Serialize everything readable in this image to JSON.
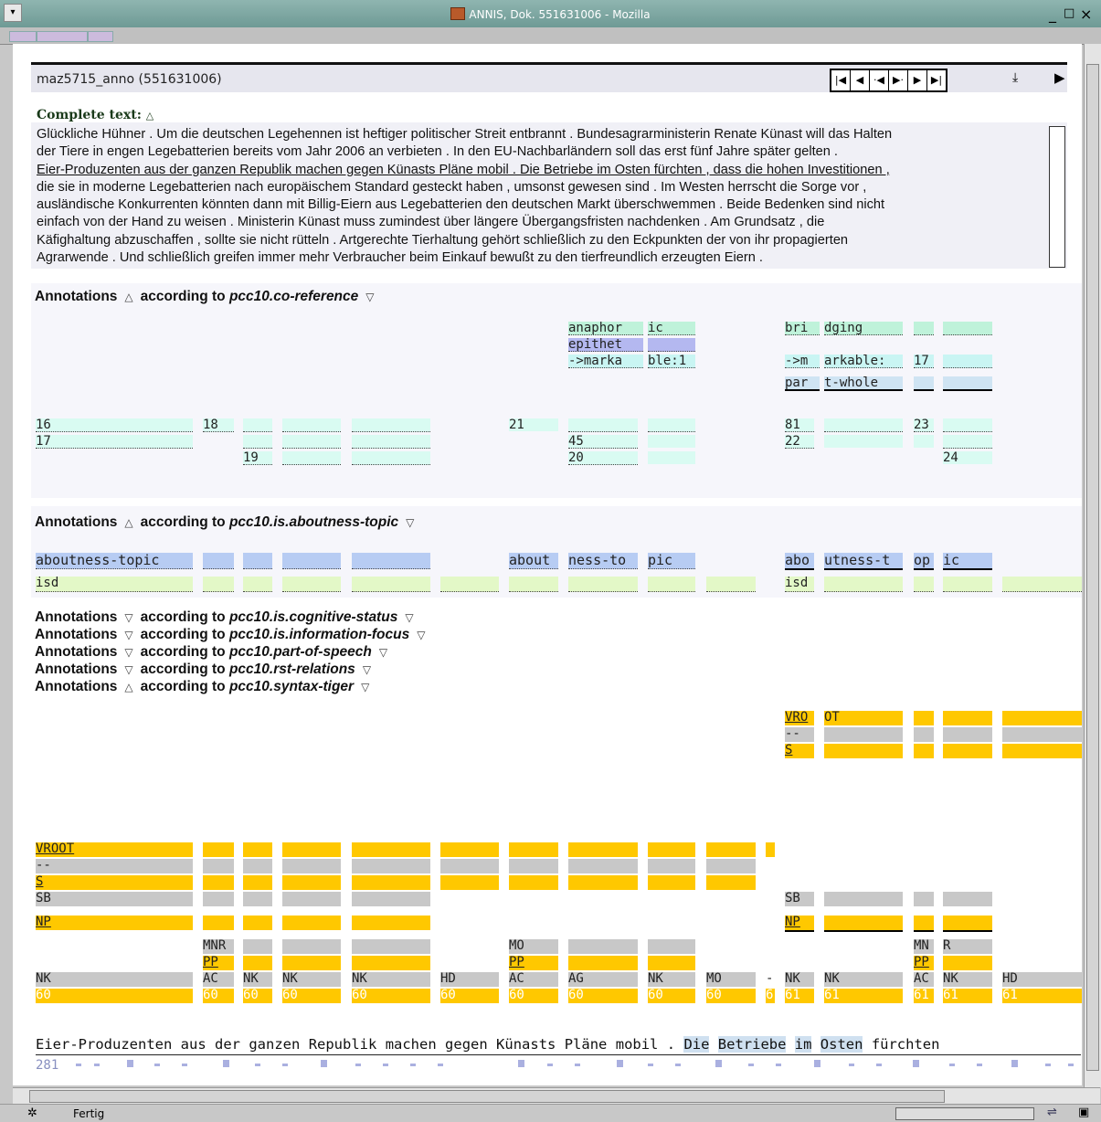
{
  "window": {
    "title": "ANNIS, Dok. 551631006 - Mozilla"
  },
  "header": {
    "doc_title": "maz5715_anno (551631006)",
    "nav": [
      "|◀",
      "◀",
      "·◀",
      "▶·",
      "▶",
      "▶|"
    ]
  },
  "complete_text": {
    "label": "Complete text:",
    "lines": [
      "Glückliche Hühner . Um die deutschen Legehennen ist heftiger politischer Streit entbrannt . Bundesagrarministerin Renate Künast will das Halten",
      "der Tiere in engen Legebatterien bereits vom Jahr 2006 an verbieten . In den EU-Nachbarländern soll das erst fünf Jahre später gelten .",
      "Eier-Produzenten aus der ganzen Republik machen gegen Künasts Pläne mobil . Die Betriebe im Osten fürchten , dass die hohen Investitionen ,",
      "die sie in moderne Legebatterien nach europäischem Standard gesteckt haben , umsonst gewesen sind . Im Westen herrscht die Sorge vor ,",
      "ausländische Konkurrenten könnten dann mit Billig-Eiern aus Legebatterien den deutschen Markt überschwemmen . Beide Bedenken sind nicht",
      "einfach von der Hand zu weisen . Ministerin Künast muss zumindest über längere Übergangsfristen nachdenken . Am Grundsatz , die",
      "Käfighaltung abzuschaffen , sollte sie nicht rütteln . Artgerechte Tierhaltung gehört schließlich zu den Eckpunkten der von ihr propagierten",
      "Agrarwende . Und schließlich greifen immer mehr Verbraucher beim Einkauf bewußt zu den tierfreundlich erzeugten Eiern ."
    ]
  },
  "annotations": {
    "word": "Annotations",
    "according": "according to",
    "sections": [
      "pcc10.co-reference",
      "pcc10.is.aboutness-topic",
      "pcc10.is.cognitive-status",
      "pcc10.is.information-focus",
      "pcc10.part-of-speech",
      "pcc10.rst-relations",
      "pcc10.syntax-tiger"
    ]
  },
  "coref": {
    "anaphor": [
      "anaphor",
      "ic"
    ],
    "epithet": "epithet",
    "marka": [
      "->marka",
      "ble:1"
    ],
    "bridging": [
      "bri",
      "dging"
    ],
    "arkable": [
      "->m",
      "arkable:",
      "17"
    ],
    "partwhole": [
      "par",
      "t-whole"
    ],
    "ids": [
      "16",
      "17",
      "18",
      "19",
      "21",
      "45",
      "20",
      "81",
      "22",
      "23",
      "24"
    ]
  },
  "aboutness": {
    "left": "aboutness-topic",
    "mid": [
      "about",
      "ness-to",
      "pic"
    ],
    "right": [
      "abo",
      "utness-t",
      "op",
      "ic"
    ],
    "isd": "isd"
  },
  "syntax": {
    "vroot": "VROOT",
    "vro": [
      "VRO",
      "OT"
    ],
    "dashes": "--",
    "s": "S",
    "sb": "SB",
    "np": "NP",
    "mnr": "MNR",
    "mo": "MO",
    "mn_r": [
      "MN",
      "R"
    ],
    "pp": "PP",
    "func": [
      "NK",
      "AC",
      "NK",
      "NK",
      "NK",
      "HD",
      "AC",
      "AG",
      "NK",
      "MO",
      "-",
      "NK",
      "NK",
      "AC",
      "NK",
      "HD"
    ],
    "nums": [
      "60",
      "60",
      "60",
      "60",
      "60",
      "60",
      "60",
      "60",
      "60",
      "60",
      "6",
      "61",
      "61",
      "61",
      "61",
      "61"
    ]
  },
  "tokens": {
    "text": [
      "Eier-Produzenten",
      "aus",
      "der",
      "ganzen",
      "Republik",
      "machen",
      "gegen",
      "Künasts",
      "Pläne",
      "mobil",
      ".",
      "Die",
      "Betriebe",
      "im",
      "Osten",
      "fürchten"
    ],
    "position": "281"
  },
  "status": {
    "text": "Fertig"
  }
}
